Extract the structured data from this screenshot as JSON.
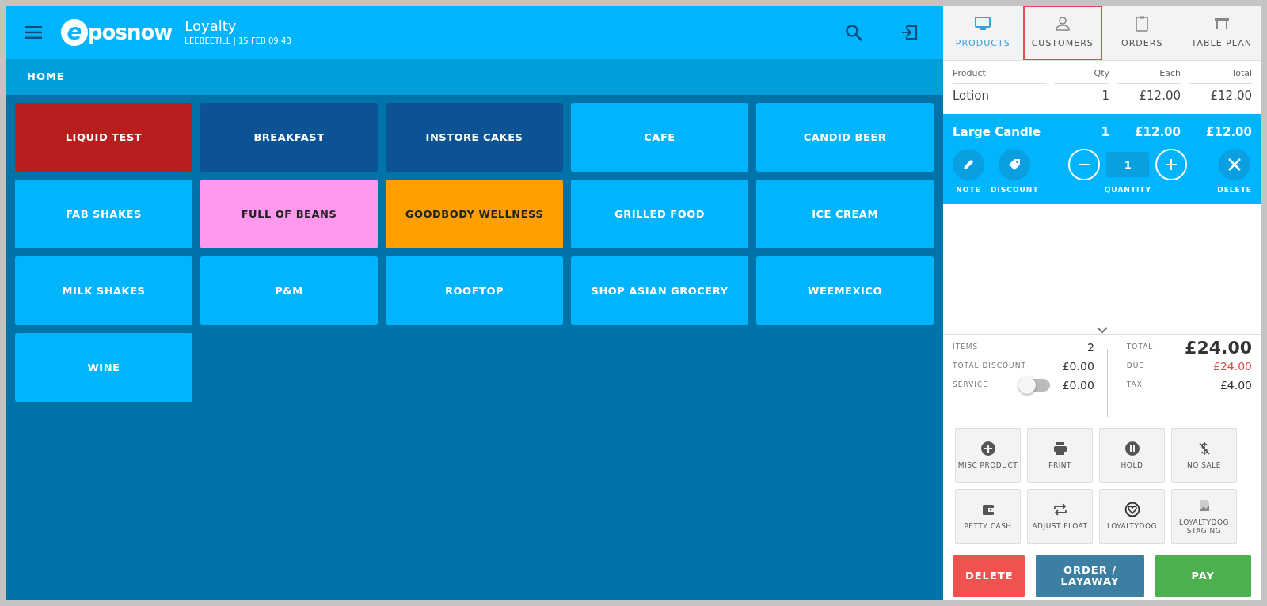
{
  "header": {
    "logo_mark": "e",
    "logo_text": "posnow",
    "title": "Loyalty",
    "subtitle": "LEEBEETILL | 15 FEB 09:43"
  },
  "breadcrumb": "HOME",
  "categories": [
    {
      "label": "LIQUID TEST",
      "color": "#b71f1f"
    },
    {
      "label": "BREAKFAST",
      "color": "#0b5394"
    },
    {
      "label": "INSTORE CAKES",
      "color": "#0b5394"
    },
    {
      "label": "CAFE",
      "color": "#00b5fd"
    },
    {
      "label": "CANDID BEER",
      "color": "#00b5fd"
    },
    {
      "label": "FAB SHAKES",
      "color": "#00b5fd"
    },
    {
      "label": "FULL OF BEANS",
      "color": "#ff99ee"
    },
    {
      "label": "GOODBODY WELLNESS",
      "color": "#ffa000"
    },
    {
      "label": "GRILLED FOOD",
      "color": "#00b5fd"
    },
    {
      "label": "ICE CREAM",
      "color": "#00b5fd"
    },
    {
      "label": "MILK SHAKES",
      "color": "#00b5fd"
    },
    {
      "label": "P&M",
      "color": "#00b5fd"
    },
    {
      "label": "ROOFTOP",
      "color": "#00b5fd"
    },
    {
      "label": "SHOP ASIAN GROCERY",
      "color": "#00b5fd"
    },
    {
      "label": "WEEMEXICO",
      "color": "#00b5fd"
    },
    {
      "label": "WINE",
      "color": "#00b5fd"
    }
  ],
  "tabs": [
    {
      "label": "PRODUCTS",
      "selected": true,
      "highlighted": false
    },
    {
      "label": "CUSTOMERS",
      "selected": false,
      "highlighted": true
    },
    {
      "label": "ORDERS",
      "selected": false,
      "highlighted": false
    },
    {
      "label": "TABLE PLAN",
      "selected": false,
      "highlighted": false
    }
  ],
  "order": {
    "columns": [
      "Product",
      "Qty",
      "Each",
      "Total"
    ],
    "lines": [
      {
        "product": "Lotion",
        "qty": "1",
        "each": "£12.00",
        "total": "£12.00",
        "selected": false
      },
      {
        "product": "Large Candle",
        "qty": "1",
        "each": "£12.00",
        "total": "£12.00",
        "selected": true
      }
    ],
    "line_actions": {
      "note": "NOTE",
      "discount": "DISCOUNT",
      "quantity_label": "QUANTITY",
      "quantity": "1",
      "delete": "DELETE"
    }
  },
  "summary": {
    "items_label": "ITEMS",
    "items": "2",
    "discount_label": "TOTAL DISCOUNT",
    "discount": "£0.00",
    "service_label": "SERVICE",
    "service_on": false,
    "service": "£0.00",
    "total_label": "TOTAL",
    "total": "£24.00",
    "due_label": "DUE",
    "due": "£24.00",
    "tax_label": "TAX",
    "tax": "£4.00"
  },
  "functions": [
    {
      "label": "MISC PRODUCT"
    },
    {
      "label": "PRINT"
    },
    {
      "label": "HOLD"
    },
    {
      "label": "NO SALE"
    },
    {
      "label": "PETTY CASH"
    },
    {
      "label": "ADJUST FLOAT"
    },
    {
      "label": "LOYALTYDOG"
    },
    {
      "label": "LOYALTYDOG STAGING"
    }
  ],
  "actions": [
    {
      "label": "DELETE",
      "color": "#ef5350"
    },
    {
      "label": "ORDER / LAYAWAY",
      "color": "#3d7fa3"
    },
    {
      "label": "PAY",
      "color": "#4caf50"
    }
  ]
}
